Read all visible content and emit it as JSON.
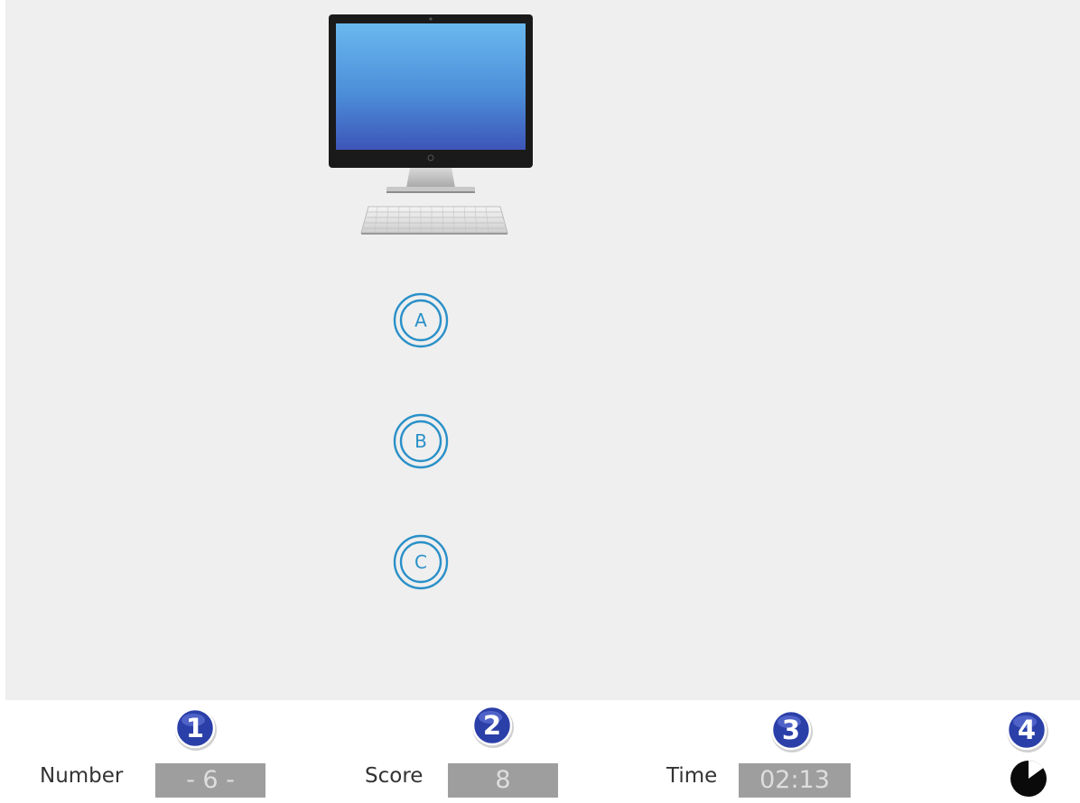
{
  "question": {
    "options": [
      {
        "letter": "A"
      },
      {
        "letter": "B"
      },
      {
        "letter": "C"
      }
    ]
  },
  "markers": [
    "1",
    "2",
    "3",
    "4"
  ],
  "status": {
    "number_label": "Number",
    "number_value": "- 6 -",
    "score_label": "Score",
    "score_value": "8",
    "time_label": "Time",
    "time_value": "02:13",
    "timer_progress": 0.15
  },
  "colors": {
    "accent": "#2a90c8",
    "marker": "#2b3fa8",
    "value_box": "#9e9e9e",
    "stage": "#efefef"
  },
  "icons": [
    "computer-icon",
    "option-a-icon",
    "option-b-icon",
    "option-c-icon",
    "timer-pie-icon"
  ]
}
